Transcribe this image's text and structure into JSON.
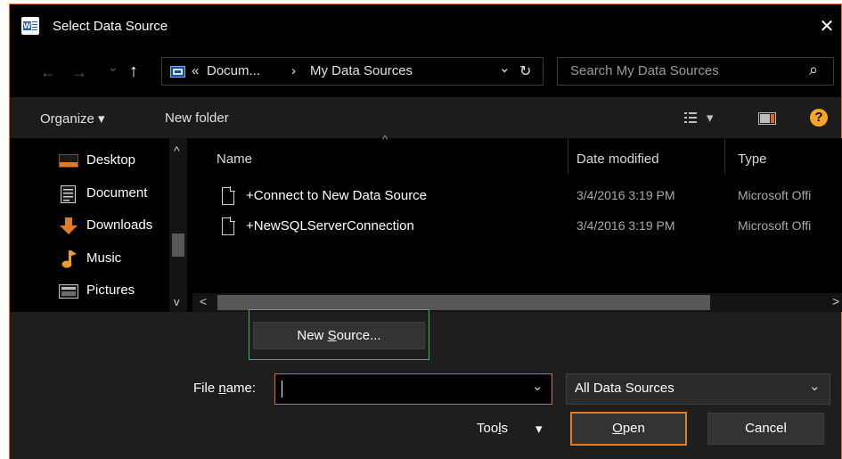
{
  "window": {
    "title": "Select Data Source",
    "icon": "word-app-icon",
    "close_glyph": "✕",
    "accent": "#d26d2a"
  },
  "nav": {
    "back_glyph": "←",
    "forward_glyph": "→",
    "recent_glyph": "⌄",
    "up_glyph": "↑",
    "breadcrumb": {
      "overflow": "«",
      "part1": "Docum...",
      "sep": "›",
      "part2": "My Data Sources"
    },
    "dropdown_glyph": "⌄",
    "refresh_glyph": "↻",
    "search_placeholder": "Search My Data Sources",
    "search_glyph": "⌕"
  },
  "toolbar": {
    "organize": "Organize",
    "caret": "▾",
    "new_folder": "New folder",
    "view_caret": "▾",
    "help": "?"
  },
  "sidebar": {
    "items": [
      {
        "label": "Desktop",
        "icon": "desktop-icon"
      },
      {
        "label": "Document",
        "icon": "documents-icon"
      },
      {
        "label": "Downloads",
        "icon": "downloads-icon"
      },
      {
        "label": "Music",
        "icon": "music-icon"
      },
      {
        "label": "Pictures",
        "icon": "pictures-icon"
      }
    ],
    "scroll_up": "^",
    "scroll_down": "v"
  },
  "files": {
    "columns": [
      "Name",
      "Date modified",
      "Type"
    ],
    "sort_glyph": "^",
    "rows": [
      {
        "name": "+Connect to New Data Source",
        "date": "3/4/2016 3:19 PM",
        "type": "Microsoft Offi"
      },
      {
        "name": "+NewSQLServerConnection",
        "date": "3/4/2016 3:19 PM",
        "type": "Microsoft Offi"
      }
    ],
    "hscroll_left": "<",
    "hscroll_right": ">"
  },
  "footer": {
    "new_source_pre": "New ",
    "new_source_ul": "S",
    "new_source_post": "ource...",
    "filename_ul": "n",
    "filename_pre": "File ",
    "filename_post": "ame:",
    "filename_value": "",
    "filetype_value": "All Data Sources",
    "tools_pre": "Too",
    "tools_ul": "l",
    "tools_post": "s",
    "open_ul": "O",
    "open_post": "pen",
    "cancel": "Cancel",
    "highlight_color": "#2fc14a"
  }
}
